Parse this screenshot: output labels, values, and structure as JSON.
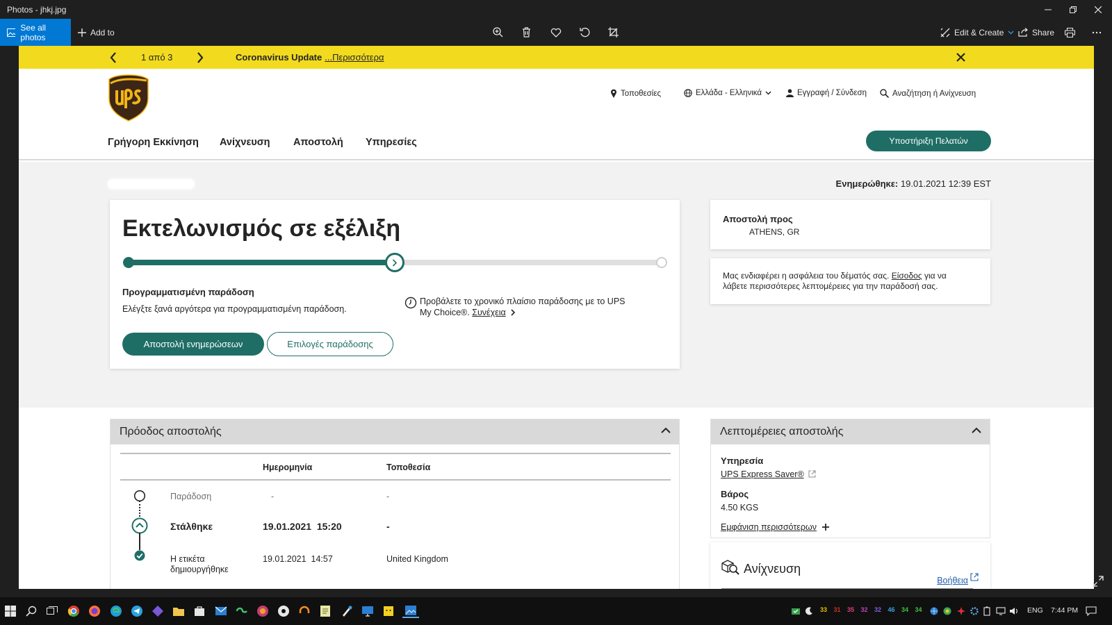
{
  "window": {
    "title": "Photos - jhkj.jpg"
  },
  "toolbar": {
    "see_all_photos": "See all photos",
    "add_to": "Add to",
    "edit_create": "Edit & Create",
    "share": "Share"
  },
  "photo": {
    "promo": {
      "pager": "1 από 3",
      "headline": "Coronavirus Update",
      "more_link": "...Περισσότερα"
    },
    "header": {
      "utility": {
        "locations": "Τοποθεσίες",
        "language": "Ελλάδα - Ελληνικά",
        "login": "Εγγραφή / Σύνδεση",
        "search": "Αναζήτηση ή Ανίχνευση"
      },
      "nav": [
        "Γρήγορη Εκκίνηση",
        "Ανίχνευση",
        "Αποστολή",
        "Υπηρεσίες"
      ],
      "support_button": "Υποστήριξη Πελατών"
    },
    "updated": {
      "label": "Ενημερώθηκε:",
      "value": "19.01.2021 12:39 EST"
    },
    "status": {
      "title": "Εκτελωνισμός σε εξέλιξη",
      "progress_fraction": 0.5,
      "scheduled_heading": "Προγραμματισμένη παράδοση",
      "scheduled_text": "Ελέγξτε ξανά αργότερα για προγραμματισμένη παράδοση.",
      "mychoice_text": "Προβάλετε το χρονικό πλαίσιο παράδοσης με το UPS My Choice®.",
      "mychoice_link": "Συνέχεια",
      "primary_button": "Αποστολή ενημερώσεων",
      "secondary_button": "Επιλογές παράδοσης"
    },
    "ship_to": {
      "label": "Αποστολή προς",
      "value": "ATHENS, GR"
    },
    "security": {
      "text_before": "Μας ενδιαφέρει η ασφάλεια του δέματός σας.",
      "link": "Είσοδος",
      "text_after": "για να λάβετε περισσότερες λεπτομέρειες για την παράδοσή σας."
    },
    "progress": {
      "title": "Πρόοδος αποστολής",
      "columns": [
        "Ημερομηνία",
        "Τοποθεσία"
      ],
      "rows": [
        {
          "event": "Παράδοση",
          "date": "-",
          "location": "-"
        },
        {
          "event": "Στάλθηκε",
          "date": "19.01.2021  15:20",
          "location": "-"
        },
        {
          "event": "Η ετικέτα δημιουργήθηκε",
          "date": "19.01.2021  14:57",
          "location": "United Kingdom"
        }
      ]
    },
    "details": {
      "title": "Λεπτομέρειες αποστολής",
      "service_label": "Υπηρεσία",
      "service_value": "UPS Express Saver®",
      "weight_label": "Βάρος",
      "weight_value": "4.50 KGS",
      "show_more": "Εμφάνιση περισσότερων"
    },
    "tracking": {
      "title": "Ανίχνευση",
      "help": "Βοήθεια"
    }
  },
  "taskbar": {
    "tray_numbers": [
      {
        "v": "33",
        "c": "#e0c000"
      },
      {
        "v": "31",
        "c": "#d03020"
      },
      {
        "v": "35",
        "c": "#e04080"
      },
      {
        "v": "32",
        "c": "#c040c0"
      },
      {
        "v": "32",
        "c": "#8060e0"
      },
      {
        "v": "46",
        "c": "#40a0e0"
      },
      {
        "v": "34",
        "c": "#40c040"
      },
      {
        "v": "34",
        "c": "#40c040"
      }
    ],
    "language": "ENG",
    "time": "7:44 PM"
  },
  "colors": {
    "ups_green": "#1f6e66",
    "promo_yellow": "#f2db1e",
    "accent_blue": "#0078d4",
    "ups_brown": "#3d2616",
    "ups_gold": "#f2b514"
  }
}
